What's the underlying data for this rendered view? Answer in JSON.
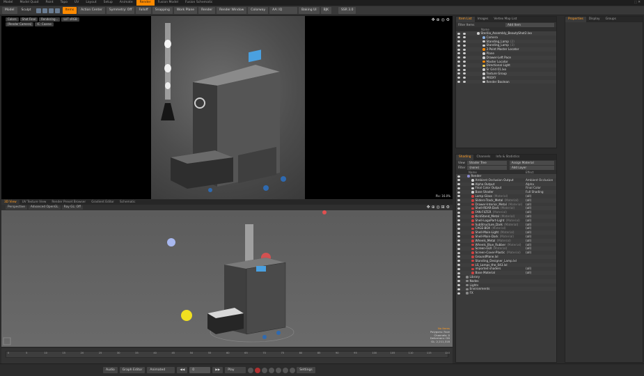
{
  "layout_tabs": [
    "Model",
    "Model Quad",
    "Paint",
    "Topo",
    "UV",
    "Layout",
    "Setup",
    "Animate",
    "Render",
    "Fusion Model",
    "Fusion Schematic"
  ],
  "layout_tabs_active": 8,
  "toolbar": {
    "mode": "Model",
    "sculpt": "Sculpt",
    "items_label": "Items",
    "action_center": "Action Center",
    "symmetry": "Symmetry: Off",
    "falloff": "Falloff",
    "snapping": "Snapping",
    "work_plane": "Work Plane",
    "render": "Render",
    "render_window": "Render Window",
    "colorway": "Colorway",
    "aa": "AA: IQ",
    "baking": "Baking UI",
    "bjk": "BJK",
    "ssr": "SSR 3.0"
  },
  "render_view": {
    "pills": [
      "Colors",
      "Shot Final",
      "Rendering...",
      "LUT sRGB",
      "[Render Camera]",
      "IC: Coarse"
    ],
    "status": "Pix: 16.0%"
  },
  "viewport_tabs": [
    "3D View",
    "UV Texture View",
    "Render Preset Browser",
    "Gradient Editor",
    "Schematic"
  ],
  "viewport_tabs_active": 0,
  "viewport_sub": [
    "Perspective",
    "Advanced OpenGL",
    "Ray GL: Off"
  ],
  "viewport_overlay": [
    "No Items",
    "Polygons: Face",
    "Channels: 0",
    "Deformers: ON",
    "GL: 2,211,318"
  ],
  "timeline": {
    "ticks": [
      "0",
      "5",
      "10",
      "15",
      "20",
      "25",
      "30",
      "35",
      "40",
      "45",
      "50",
      "55",
      "60",
      "65",
      "70",
      "75",
      "80",
      "85",
      "90",
      "95",
      "100",
      "105",
      "110",
      "115",
      "120"
    ],
    "end": "120"
  },
  "bottombar": {
    "audio": "Audio",
    "graph_editor": "Graph Editor",
    "animated": "Animated",
    "frame": "0",
    "play": "Play",
    "settings": "Settings"
  },
  "item_list": {
    "tabs": [
      "Item List",
      "Images",
      "Vertex Map List"
    ],
    "filter_label": "Filter Items",
    "add_item": "Add Item",
    "column": "Name",
    "items": [
      {
        "name": "Sterilio_Assembly_BeautyShot2.lxo",
        "sub": "",
        "color": "#cfcfcf"
      },
      {
        "name": "Camera",
        "sub": "",
        "color": "#8ab0e0"
      },
      {
        "name": "Standing_Lamp",
        "sub": "(2)",
        "color": "#cfcfcf"
      },
      {
        "name": "Standing_Lamp",
        "sub": "(3)",
        "color": "#cfcfcf"
      },
      {
        "name": "3 Point Master Locator",
        "sub": "",
        "color": "#ff8a00"
      },
      {
        "name": "Plane",
        "sub": "",
        "color": "#cfcfcf"
      },
      {
        "name": "Drawer-Left Pace",
        "sub": "",
        "color": "#cfcfcf"
      },
      {
        "name": "Master Locator",
        "sub": "",
        "color": "#ff8a00"
      },
      {
        "name": "Directional Light",
        "sub": "",
        "color": "#f0d060"
      },
      {
        "name": "Sr Grid 01.lxo",
        "sub": "",
        "color": "#cfcfcf"
      },
      {
        "name": "Texture Group",
        "sub": "",
        "color": "#cfcfcf"
      },
      {
        "name": "PROXY",
        "sub": "",
        "color": "#cfcfcf"
      },
      {
        "name": "Render Boolean",
        "sub": "",
        "color": "#cfcfcf"
      }
    ]
  },
  "props_tabs": [
    "Properties",
    "Display",
    "Groups"
  ],
  "shading": {
    "tabs": [
      "Shading",
      "Channels",
      "Info & Statistics"
    ],
    "view_label": "View",
    "view_value": "Shader Tree",
    "assign_material": "Assign Material",
    "filter_label": "Filter",
    "filter_value": "(none)",
    "add_layer": "Add Layer",
    "col_name": "Name",
    "col_effect": "Effect",
    "items": [
      {
        "name": "Render",
        "sub": "",
        "effect": "",
        "color": "#8a8acf"
      },
      {
        "name": "Ambient Occlusion Output",
        "sub": "",
        "effect": "Ambient Occlusion",
        "color": "#cfcfcf"
      },
      {
        "name": "Alpha Output",
        "sub": "",
        "effect": "Alpha",
        "color": "#cfcfcf"
      },
      {
        "name": "Final Color Output",
        "sub": "",
        "effect": "Final Color",
        "color": "#cfcfcf"
      },
      {
        "name": "Base Shader",
        "sub": "",
        "effect": "Full Shading",
        "color": "#cfcfcf"
      },
      {
        "name": "Lamp-Glass",
        "sub": "(Material)",
        "effect": "(all)",
        "color": "#d04040"
      },
      {
        "name": "Sliders-Track_Metal",
        "sub": "(Material)",
        "effect": "(all)",
        "color": "#d04040"
      },
      {
        "name": "Drawer-Interior_Metal",
        "sub": "(Material)",
        "effect": "(all)",
        "color": "#d04040"
      },
      {
        "name": "Shell-REAR-Dark",
        "sub": "(Material)",
        "effect": "(all)",
        "color": "#d04040"
      },
      {
        "name": "FAN-FILTER",
        "sub": "(Material)",
        "effect": "(all)",
        "color": "#d04040"
      },
      {
        "name": "KickStand_Metal",
        "sub": "(Material)",
        "effect": "(all)",
        "color": "#d04040"
      },
      {
        "name": "Shell-LogoPart-Light",
        "sub": "(Material)",
        "effect": "(all)",
        "color": "#d04040"
      },
      {
        "name": "SubStructure_Dark",
        "sub": "(Material)",
        "effect": "(all)",
        "color": "#d04040"
      },
      {
        "name": "CAGE-BOX",
        "sub": "(Material)",
        "effect": "(all)",
        "color": "#d04040"
      },
      {
        "name": "Shell-Main-Light",
        "sub": "(Material)",
        "effect": "(all)",
        "color": "#d04040"
      },
      {
        "name": "Shell-Main-Dark",
        "sub": "(Material)",
        "effect": "(all)",
        "color": "#d04040"
      },
      {
        "name": "Wheels_Metal",
        "sub": "(Material)",
        "effect": "(all)",
        "color": "#d04040"
      },
      {
        "name": "Wheels_Blue_Rubber",
        "sub": "(Material)",
        "effect": "(all)",
        "color": "#d04040"
      },
      {
        "name": "Screen-GUI",
        "sub": "(Material)",
        "effect": "(all)",
        "color": "#d04040"
      },
      {
        "name": "Screen-Cover-Plastic",
        "sub": "(Material)",
        "effect": "(all)",
        "color": "#d04040"
      },
      {
        "name": "GroundPlane.lxl",
        "sub": "",
        "effect": "",
        "color": "#d04040"
      },
      {
        "name": "Standing_Designer_Lamp.lxl",
        "sub": "",
        "effect": "",
        "color": "#d04040"
      },
      {
        "name": "LS_Lamps_the_043.lxl",
        "sub": "",
        "effect": "",
        "color": "#d04040"
      },
      {
        "name": "imported shaders",
        "sub": "",
        "effect": "(all)",
        "color": "#d04040"
      },
      {
        "name": "Base Material",
        "sub": "",
        "effect": "(all)",
        "color": "#d04040"
      },
      {
        "name": "Library",
        "sub": "",
        "effect": "",
        "color": "#8a8a8a"
      },
      {
        "name": "Nodes",
        "sub": "",
        "effect": "",
        "color": "#8a8a8a"
      },
      {
        "name": "Lights",
        "sub": "",
        "effect": "",
        "color": "#8a8a8a"
      },
      {
        "name": "Environments",
        "sub": "",
        "effect": "",
        "color": "#8a8a8a"
      },
      {
        "name": "FX",
        "sub": "",
        "effect": "",
        "color": "#8a8a8a"
      }
    ]
  }
}
